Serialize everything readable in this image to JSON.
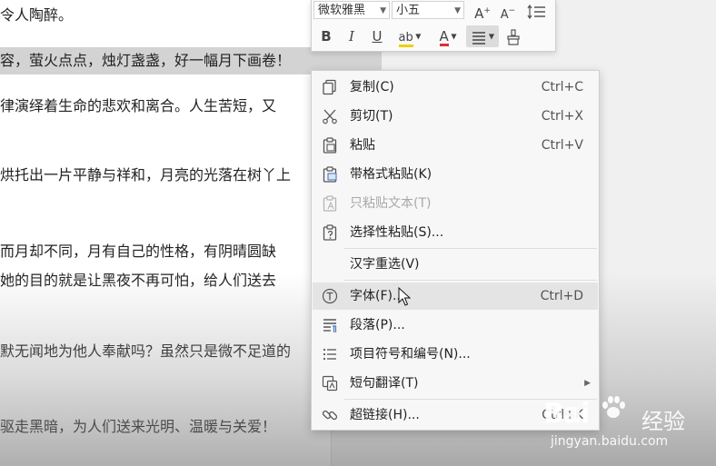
{
  "document": {
    "lines": [
      {
        "text": "令人陶醉。",
        "selected": false
      },
      {
        "text": "容，萤火点点，烛灯盏盏，好一幅月下画卷！",
        "selected": true
      },
      {
        "text": "律演绎着生命的悲欢和离合。人生苦短，又",
        "selected": false
      },
      {
        "text": "烘托出一片平静与祥和，月亮的光落在树丫上",
        "selected": false
      },
      {
        "text": "而月却不同，月有自己的性格，有阴晴圆缺",
        "selected": false
      },
      {
        "text": "她的目的就是让黑夜不再可怕，给人们送去",
        "selected": false
      },
      {
        "text": "默无闻地为他人奉献吗？虽然只是微不足道的",
        "selected": false
      },
      {
        "text": "驱走黑暗，为人们送来光明、温暖与关爱！",
        "selected": false
      }
    ]
  },
  "mini_toolbar": {
    "font_name": "微软雅黑",
    "font_size": "小五",
    "grow_font_label": "A",
    "shrink_font_label": "A",
    "bold_label": "B",
    "italic_label": "I",
    "underline_label": "U",
    "highlight_label": "ab",
    "font_color_label": "A"
  },
  "context_menu": {
    "items": [
      {
        "label": "复制(C)",
        "shortcut": "Ctrl+C",
        "icon": "copy-icon",
        "disabled": false
      },
      {
        "label": "剪切(T)",
        "shortcut": "Ctrl+X",
        "icon": "scissors-icon",
        "disabled": false
      },
      {
        "label": "粘贴",
        "shortcut": "Ctrl+V",
        "icon": "paste-icon",
        "disabled": false
      },
      {
        "label": "带格式粘贴(K)",
        "shortcut": "",
        "icon": "paste-format-icon",
        "disabled": false
      },
      {
        "label": "只粘贴文本(T)",
        "shortcut": "",
        "icon": "paste-text-icon",
        "disabled": true
      },
      {
        "label": "选择性粘贴(S)...",
        "shortcut": "",
        "icon": "paste-special-icon",
        "disabled": false
      },
      {
        "label": "汉字重选(V)",
        "shortcut": "",
        "icon": "",
        "disabled": false
      },
      {
        "label": "字体(F)...",
        "shortcut": "Ctrl+D",
        "icon": "font-icon",
        "disabled": false
      },
      {
        "label": "段落(P)...",
        "shortcut": "",
        "icon": "paragraph-icon",
        "disabled": false
      },
      {
        "label": "项目符号和编号(N)...",
        "shortcut": "",
        "icon": "bullets-icon",
        "disabled": false
      },
      {
        "label": "短句翻译(T)",
        "shortcut": "",
        "icon": "translate-icon",
        "disabled": false
      },
      {
        "label": "超链接(H)...",
        "shortcut": "Ctrl+K",
        "icon": "link-icon",
        "disabled": false
      }
    ]
  },
  "watermark": {
    "brand": "Bai",
    "brand_suffix": "经验",
    "url": "jingyan.baidu.com"
  },
  "colors": {
    "selection": "#d3d3d3",
    "menu_background": "#f7f7f7",
    "menu_hover": "#e4e4e4",
    "font_color_underline": "#e03030",
    "highlight_underline": "#f0d000"
  }
}
